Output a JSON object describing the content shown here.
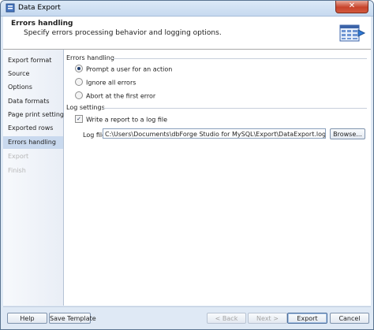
{
  "window": {
    "title": "Data Export",
    "close_glyph": "✕"
  },
  "header": {
    "title": "Errors handling",
    "description": "Specify errors processing behavior and logging options."
  },
  "sidebar": {
    "items": [
      {
        "label": "Export format",
        "state": "normal"
      },
      {
        "label": "Source",
        "state": "normal"
      },
      {
        "label": "Options",
        "state": "normal"
      },
      {
        "label": "Data formats",
        "state": "normal"
      },
      {
        "label": "Page print settings",
        "state": "normal"
      },
      {
        "label": "Exported rows",
        "state": "normal"
      },
      {
        "label": "Errors handling",
        "state": "active"
      },
      {
        "label": "Export",
        "state": "disabled"
      },
      {
        "label": "Finish",
        "state": "disabled"
      }
    ]
  },
  "errors_handling": {
    "group_label": "Errors handling",
    "options": [
      {
        "label": "Prompt a user for an action",
        "checked": true
      },
      {
        "label": "Ignore all errors",
        "checked": false
      },
      {
        "label": "Abort at the first error",
        "checked": false
      }
    ]
  },
  "log_settings": {
    "group_label": "Log settings",
    "write_log": {
      "label": "Write a report to a log file",
      "checked": true,
      "check_glyph": "✓"
    },
    "log_file_label": "Log file:",
    "log_file_value": "C:\\Users\\Documents\\dbForge Studio for MySQL\\Export\\DataExport.log",
    "browse_label": "Browse..."
  },
  "footer": {
    "help_label": "Help",
    "save_template_label": "Save Template",
    "back_label": "< Back",
    "next_label": "Next >",
    "export_label": "Export",
    "cancel_label": "Cancel"
  },
  "colors": {
    "accent": "#1f4e96",
    "active_item": "#c9d9ee",
    "window_frame": "#dfe9f5"
  }
}
